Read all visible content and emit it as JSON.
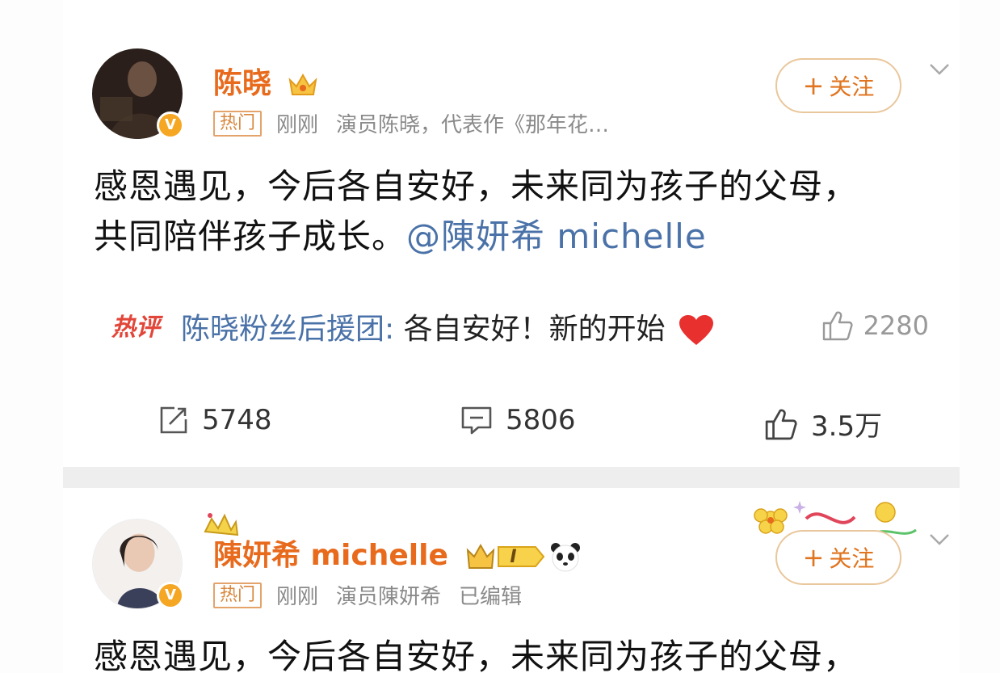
{
  "post1": {
    "username": "陈晓",
    "hot_tag": "热门",
    "time": "刚刚",
    "bio": "演员陈晓，代表作《那年花…",
    "follow_label": "关注",
    "text_line1": "感恩遇见，今后各自安好，未来同为孩子的父母，",
    "text_line2": "共同陪伴孩子成长。",
    "mention": "@陳妍希 michelle",
    "hot_comment": {
      "tag": "热评",
      "user": "陈晓粉丝后援团:",
      "text": " 各自安好！新的开始",
      "likes": "2280"
    },
    "actions": {
      "repost": "5748",
      "comment": "5806",
      "like": "3.5万"
    }
  },
  "post2": {
    "username": "陳妍希 michelle",
    "hot_tag": "热门",
    "time": "刚刚",
    "bio": "演员陳妍希",
    "edited": "已编辑",
    "follow_label": "关注",
    "level": "I",
    "text_line1": "感恩遇见，今后各自安好，未来同为孩子的父母，"
  },
  "colors": {
    "username": "#e86a1c",
    "mention": "#4a72a8",
    "hot_comment_tag": "#e2463a",
    "verified_badge": "#f5a623"
  }
}
